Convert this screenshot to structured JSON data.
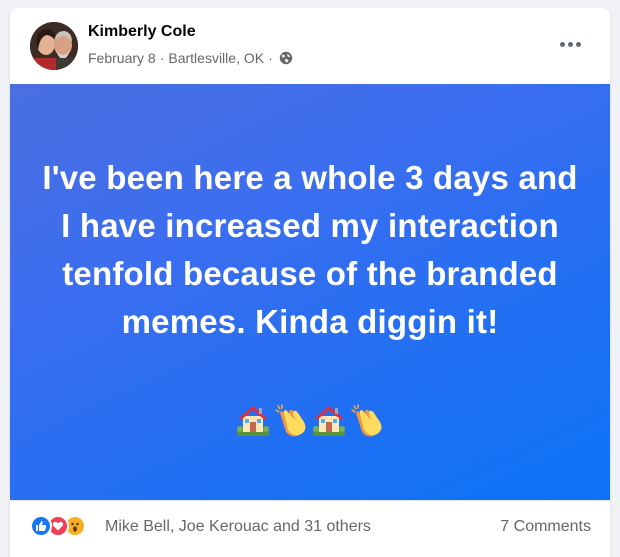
{
  "post": {
    "author": "Kimberly Cole",
    "date": "February 8",
    "separator1": "·",
    "location": "Bartlesville, OK",
    "separator2": "·",
    "privacy_icon": "globe-icon",
    "more_icon": "more-options-icon",
    "text": "I've been here a whole 3 days and I have increased my interaction tenfold because of the branded memes. Kinda diggin it!",
    "emojis": [
      "house-with-garden",
      "clapping-hands",
      "house-with-garden",
      "clapping-hands"
    ],
    "background_colors": [
      "#4a6fe0",
      "#0c73f7"
    ]
  },
  "footer": {
    "reactions": [
      "like",
      "love",
      "wow"
    ],
    "reaction_summary": "Mike Bell, Joe Kerouac and 31 others",
    "comments": "7 Comments"
  }
}
